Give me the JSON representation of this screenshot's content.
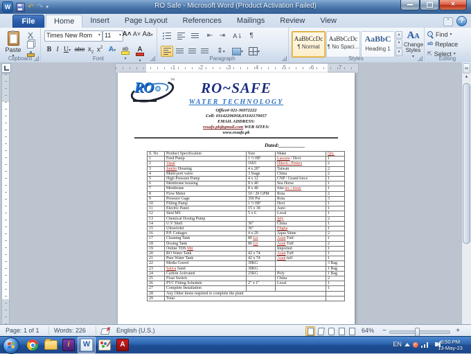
{
  "titlebar": {
    "title": "RO Safe -  Microsoft Word (Product Activation Failed)"
  },
  "tabs": {
    "file": "File",
    "items": [
      "Home",
      "Insert",
      "Page Layout",
      "References",
      "Mailings",
      "Review",
      "View"
    ],
    "active": "Home"
  },
  "ribbon": {
    "clipboard": {
      "label": "Clipboard",
      "paste": "Paste"
    },
    "font": {
      "label": "Font",
      "family": "Times New Rom",
      "size": "11"
    },
    "paragraph": {
      "label": "Paragraph"
    },
    "styles": {
      "label": "Styles",
      "gallery": [
        {
          "preview": "AaBbCcDc",
          "name": "¶ Normal",
          "selected": true,
          "heading": false
        },
        {
          "preview": "AaBbCcDc",
          "name": "¶ No Spaci...",
          "selected": false,
          "heading": false
        },
        {
          "preview": "AaBbC",
          "name": "Heading 1",
          "selected": false,
          "heading": true
        }
      ],
      "change_styles_line1": "Change",
      "change_styles_line2": "Styles"
    },
    "editing": {
      "label": "Editing",
      "items": [
        "Find",
        "Replace",
        "Select"
      ]
    }
  },
  "ruler": {
    "h_numbers": [
      "1",
      "2",
      "3",
      "4",
      "5",
      "6",
      "7"
    ]
  },
  "document": {
    "logo_text": "RO",
    "logo_tm": "TM",
    "title": "RO~SAFE",
    "subtitle": "WATER  TECHNOLOGY",
    "contact_line1": "Office# 021-36972222",
    "contact_line2": "Cell: 03142296958,03102170057",
    "contact_line3": "EMAIL ADDRESS:",
    "email": "rosafe.pk@gmail.com",
    "web_label": " WEB SITES:",
    "website": "www.rosafe.pk",
    "dated": "Dated:__________",
    "table": {
      "headers": [
        "S. No",
        "Product Specification",
        "Size",
        "Make",
        "~Qty.~"
      ],
      "rows": [
        {
          "no": "1",
          "product": "Feed Pump",
          "size": "1 ½ HP",
          "make": "~Lascara~ / Devi",
          "qty": "1"
        },
        {
          "no": "2",
          "product": "~Vasal~",
          "size": "1665",
          "make": "~Hitech / Pentex~",
          "qty": "2"
        },
        {
          "no": "3",
          "product": "~Jambo~ Housing",
          "size": "4 x 20\"",
          "make": "Taiwan",
          "qty": "2"
        },
        {
          "no": "4",
          "product": "Multi-port valve",
          "size": "3 Stage",
          "make": "China",
          "qty": "2"
        },
        {
          "no": "5",
          "product": "High Pressure Pump",
          "size": "4 x 12",
          "make": "CNP / Grand force",
          "qty": "1"
        },
        {
          "no": "6",
          "product": "Membrane housing",
          "size": "8 x 40",
          "make": "Sea Horse",
          "qty": "1"
        },
        {
          "no": "7",
          "product": "Membrane",
          "size": "8 x 40",
          "make": "film ~tec / toray~",
          "qty": "1"
        },
        {
          "no": "8",
          "product": "Flow Meter",
          "size": "10 / 20 GPM",
          "make": "Rota",
          "qty": "2"
        },
        {
          "no": "9",
          "product": "Pressure Gage",
          "size": "350 Psi",
          "make": "Rota",
          "qty": "3"
        },
        {
          "no": "10",
          "product": "Filling Pump",
          "size": "1 ½ HP",
          "make": "Devi",
          "qty": "1"
        },
        {
          "no": "11",
          "product": "Electric Panel",
          "size": "15 x 18",
          "make": "Auto",
          "qty": "1"
        },
        {
          "no": "12",
          "product": "Skid MS",
          "size": "5 x 6",
          "make": "Local",
          "qty": "1"
        },
        {
          "no": "13",
          "product": "Chemical Dosing Pump",
          "size": "",
          "make": "~Jely~",
          "qty": "2"
        },
        {
          "no": "14",
          "product": "U.V Shell",
          "size": "36\"",
          "make": "China",
          "qty": "1"
        },
        {
          "no": "15",
          "product": "Ultraviolet",
          "size": "36\"",
          "make": "~Filgba~",
          "qty": "1"
        },
        {
          "no": "16",
          "product": "P.P. Cottages",
          "size": "4 x 20",
          "make": "Aqua Shine",
          "qty": "2"
        },
        {
          "no": "17",
          "product": "Cleaning Tank",
          "size": "80 ~Ltr~",
          "make": "~Azan~ Tuff",
          "qty": "1"
        },
        {
          "no": "18",
          "product": "Dosing Tank",
          "size": "80 ~Ltr~",
          "make": "~Azan~ Tuff",
          "qty": "2"
        },
        {
          "no": "19",
          "product": "Online TDS ~Mtr~",
          "size": "",
          "make": "Imported",
          "qty": "1"
        },
        {
          "no": "20",
          "product": "RO Water Tank",
          "size": "42 x 74",
          "make": "~Azan~ Tuff",
          "qty": "1"
        },
        {
          "no": "21",
          "product": "Pure Water Tank",
          "size": "42 x 74",
          "make": "~Azan~ tuff",
          "qty": "1"
        },
        {
          "no": "22",
          "product": "Media Gravel",
          "size": "30KG",
          "make": "",
          "qty": "3 Bag"
        },
        {
          "no": "23",
          "product": "~Salica~ Sand",
          "size": "30KG",
          "make": "",
          "qty": "1 Bag"
        },
        {
          "no": "24",
          "product": "Carbon Activated",
          "size": "25KG",
          "make": "Poly",
          "qty": "1 Bag"
        },
        {
          "no": "25",
          "product": "Float Switch",
          "size": "",
          "make": "China",
          "qty": "2"
        },
        {
          "no": "26",
          "product": "PVC Fitting Schedule",
          "size": "2\" x 1\"",
          "make": "Local",
          "qty": "1"
        },
        {
          "no": "27",
          "product": "Complete Installation",
          "size": "",
          "make": "",
          "qty": "1"
        },
        {
          "no": "28",
          "product": "Any Other items required to complete the plant",
          "span": true,
          "qty": ""
        },
        {
          "no": "29",
          "product": "Total",
          "span": true,
          "qty": ""
        }
      ]
    }
  },
  "statusbar": {
    "page": "Page: 1 of 1",
    "words": "Words: 226",
    "language": "English (U.S.)",
    "zoom_level": "64%"
  },
  "taskbar": {
    "tray_language": "EN",
    "time": "6:50 PM",
    "date": "13-May-23"
  },
  "colors": {
    "title_navy": "#1c2e80",
    "subtitle_blue": "#2f73c4",
    "spell_red": "#b03026",
    "taskbar_blue": "#2f68b2"
  }
}
